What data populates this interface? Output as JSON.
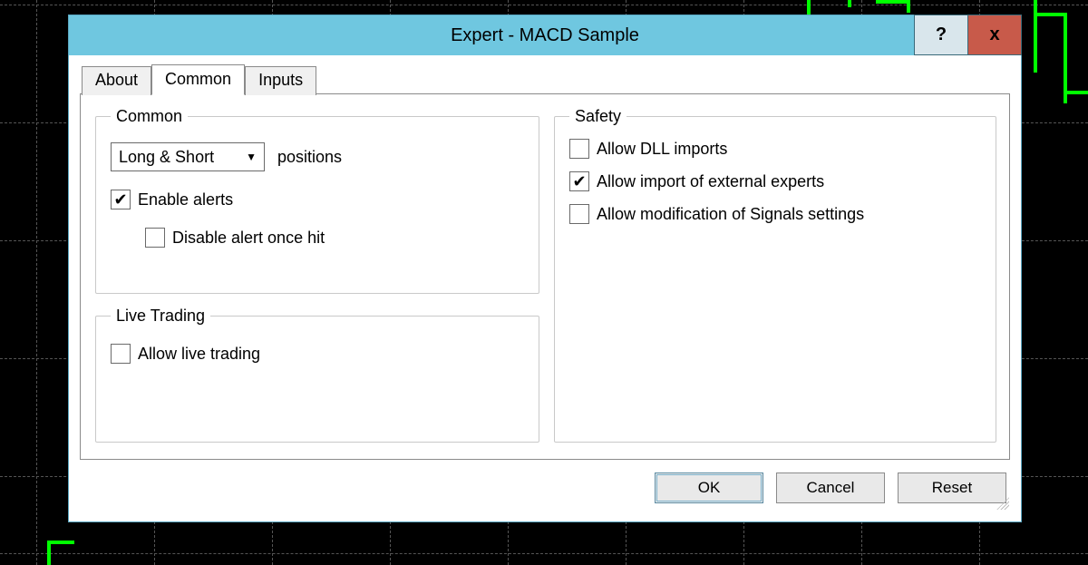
{
  "window": {
    "title": "Expert - MACD Sample",
    "help_label": "?",
    "close_label": "x"
  },
  "tabs": {
    "about": "About",
    "common": "Common",
    "inputs": "Inputs"
  },
  "groups": {
    "common": {
      "legend": "Common",
      "positions_selected": "Long & Short",
      "positions_label": "positions",
      "enable_alerts": {
        "label": "Enable alerts",
        "checked": true
      },
      "disable_alert_once_hit": {
        "label": "Disable alert once hit",
        "checked": false
      }
    },
    "live_trading": {
      "legend": "Live Trading",
      "allow_live_trading": {
        "label": "Allow live trading",
        "checked": false
      }
    },
    "safety": {
      "legend": "Safety",
      "allow_dll_imports": {
        "label": "Allow DLL imports",
        "checked": false
      },
      "allow_import_external_experts": {
        "label": "Allow import of external experts",
        "checked": true
      },
      "allow_mod_signals": {
        "label": "Allow modification of Signals settings",
        "checked": false
      }
    }
  },
  "buttons": {
    "ok": "OK",
    "cancel": "Cancel",
    "reset": "Reset"
  }
}
